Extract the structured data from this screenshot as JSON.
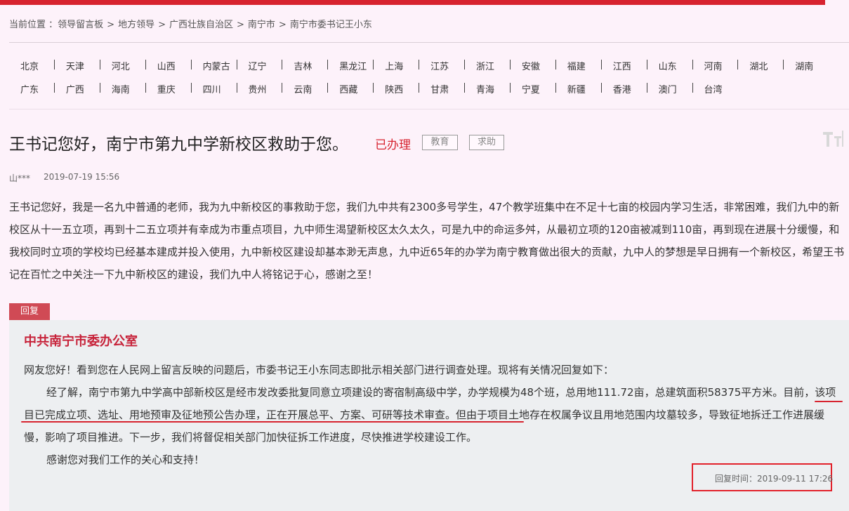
{
  "breadcrumb": {
    "label": "当前位置 ：",
    "items": [
      "领导留言板",
      "地方领导",
      "广西壮族自治区",
      "南宁市",
      "南宁市委书记王小东"
    ]
  },
  "regions": {
    "row1": [
      "北京",
      "天津",
      "河北",
      "山西",
      "内蒙古",
      "辽宁",
      "吉林",
      "黑龙江",
      "上海",
      "江苏",
      "浙江",
      "安徽",
      "福建",
      "江西",
      "山东",
      "河南",
      "湖北",
      "湖南"
    ],
    "row2": [
      "广东",
      "广西",
      "海南",
      "重庆",
      "四川",
      "贵州",
      "云南",
      "西藏",
      "陕西",
      "甘肃",
      "青海",
      "宁夏",
      "新疆",
      "香港",
      "澳门",
      "台湾"
    ]
  },
  "message": {
    "title": "王书记您好，南宁市第九中学新校区救助于您。",
    "status": "已办理",
    "tags": [
      "教育",
      "求助"
    ],
    "author": "山***",
    "time": "2019-07-19 15:56",
    "content": "王书记您好，我是一名九中普通的老师，我为九中新校区的事救助于您，我们九中共有2300多号学生，47个教学班集中在不足十七亩的校园内学习生活，非常困难，我们九中的新校区从十一五立项，再到十二五立项并有幸成为市重点项目，九中师生渴望新校区太久太久，可是九中的命运多舛，从最初立项的120亩被减到110亩，再到现在进展十分缓慢，和我校同时立项的学校均已经基本建成并投入使用，九中新校区建设却基本渺无声息，九中近65年的办学为南宁教育做出很大的贡献，九中人的梦想是早日拥有一个新校区，希望王书记在百忙之中关注一下九中新校区的建设，我们九中人将铭记于心，感谢之至！"
  },
  "reply": {
    "badge": "回复",
    "org": "中共南宁市委办公室",
    "paragraphs": [
      "网友您好！看到您在人民网上留言反映的问题后，市委书记王小东同志即批示相关部门进行调查处理。现将有关情况回复如下：",
      "经了解，南宁市第九中学高中部新校区是经市发改委批复同意立项建设的寄宿制高级中学，办学规模为48个班，总用地111.72亩，总建筑面积58375平方米。目前，该项目已完成立项、选址、用地预审及征地预公告办理，正在开展总平、方案、可研等技术审查。但由于项目土地存在权属争议且用地范围内坟墓较多，导致征地拆迁工作进展缓慢，影响了项目推进。下一步，我们将督促相关部门加快征拆工作进度，尽快推进学校建设工作。",
      "感谢您对我们工作的关心和支持！"
    ],
    "time_label": "回复时间：",
    "time": "2019-09-11 17:26"
  },
  "colors": {
    "accent": "#d7232f",
    "background": "#fdf2fa",
    "reply_background": "#edeff1"
  },
  "icons": [
    "font-size-icon"
  ]
}
